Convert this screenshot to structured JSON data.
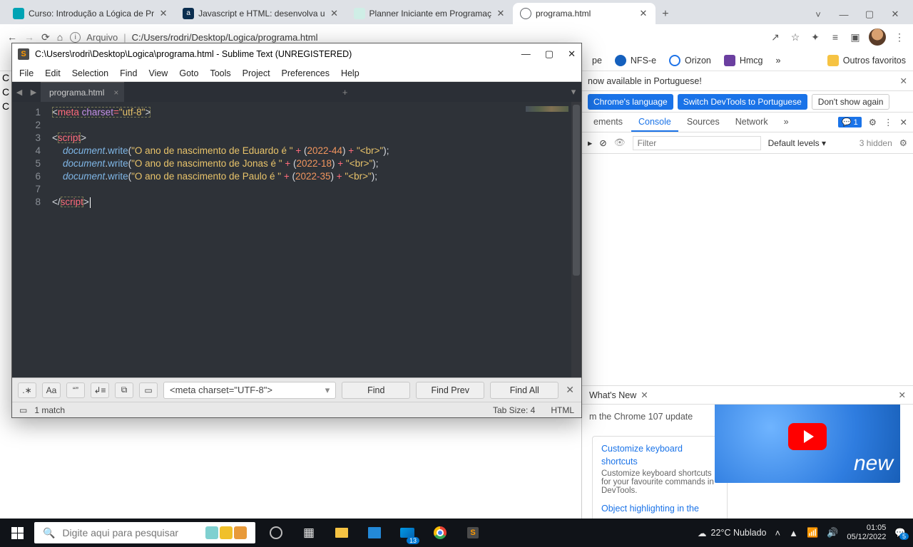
{
  "chrome": {
    "tabs": [
      {
        "title": "Curso: Introdução a Lógica de Pr",
        "favcolor": "#00a3b4"
      },
      {
        "title": "Javascript e HTML: desenvolva u",
        "favcolor": "#0b2e4f"
      },
      {
        "title": "Planner Iniciante em Programaç",
        "favcolor": "#7fc4b5"
      },
      {
        "title": "programa.html",
        "favcolor": "#5f6368",
        "active": true
      }
    ],
    "newtab_tip": "+",
    "wincontrols": {
      "chevron": "˅",
      "min": "—",
      "max": "▢",
      "close": "✕"
    },
    "toolbar": {
      "url_scheme": "Arquivo",
      "url_path": "C:/Users/rodri/Desktop/Logica/programa.html",
      "share": "↗",
      "star": "☆",
      "ext": "✦",
      "list": "≡",
      "panel": "▣",
      "menu": "⋮"
    },
    "bookmarks": {
      "left_cut": "pe",
      "items": [
        {
          "label": "NFS-e",
          "color": "#1560bd"
        },
        {
          "label": "Orizon",
          "color": "#1e73e8"
        },
        {
          "label": "Hmcg",
          "color": "#6b3fa0"
        }
      ],
      "overflow": "»",
      "other": "Outros favoritos",
      "folder": "📁"
    }
  },
  "devtools": {
    "lang_msg": "now available in Portuguese!",
    "btn_lang_chrome": "Chrome's language",
    "btn_lang_pt": "Switch DevTools to Portuguese",
    "btn_dont": "Don't show again",
    "tabs": {
      "elements": "ements",
      "console": "Console",
      "sources": "Sources",
      "network": "Network",
      "more": "»"
    },
    "issues_count": "1",
    "gear": "⚙",
    "kebab": "⋮",
    "close": "✕",
    "filter_placeholder": "Filter",
    "levels": "Default levels ▾",
    "hidden": "3 hidden",
    "hidden_gear": "⚙",
    "top": "▸",
    "eye": "👁",
    "clear": "⊘",
    "drawer": {
      "title": "What's New",
      "close": "✕",
      "subtitle": "m the Chrome 107 update",
      "card1_link1": "Customize keyboard",
      "card1_link2": "shortcuts",
      "card1_text": "Customize keyboard shortcuts for your favourite commands in DevTools.",
      "card2_link": "Object highlighting in the",
      "video_label": "new"
    }
  },
  "page_left_lines": [
    "C",
    "C",
    "C"
  ],
  "sublime": {
    "title": "C:\\Users\\rodri\\Desktop\\Logica\\programa.html - Sublime Text (UNREGISTERED)",
    "logo": "S",
    "win_min": "—",
    "win_max": "▢",
    "win_close": "✕",
    "menu": [
      "File",
      "Edit",
      "Selection",
      "Find",
      "View",
      "Goto",
      "Tools",
      "Project",
      "Preferences",
      "Help"
    ],
    "tab_name": "programa.html",
    "tab_x": "×",
    "tab_plus": "+",
    "tab_dd": "▾",
    "nav_l": "◀",
    "nav_r": "▶",
    "code": {
      "l1": {
        "open": "<",
        "tag": "meta",
        "sp": " ",
        "attr": "charset",
        "eq": "=",
        "val": "\"utf-8\"",
        "close": ">"
      },
      "l3": {
        "open": "<",
        "tag": "script",
        "close": ">"
      },
      "doc": "document",
      "dot": ".",
      "write": "write",
      "lp": "(",
      "s4a": "\"O ano de nascimento de Eduardo é \"",
      "plus": " + ",
      "n4a": "2022",
      "minus": "-",
      "n4b": "44",
      "s4b": "\"<br>\"",
      "rp": ")",
      "semi": ";",
      "s5a": "\"O ano de nascimento de Jonas é \"",
      "n5b": "18",
      "s6a": "\"O ano de nascimento de Paulo é \"",
      "n6b": "35",
      "l8": {
        "open": "</",
        "tag": "script",
        "close": ">"
      }
    },
    "find": {
      "opts": [
        ".∗",
        "Aa",
        "“”",
        "↲≡",
        "⧉",
        "▭"
      ],
      "input": "<meta charset=\"UTF-8\">",
      "dd": "▾",
      "find": "Find",
      "prev": "Find Prev",
      "all": "Find All",
      "close": "✕"
    },
    "status": {
      "sel": "▭",
      "match": "1 match",
      "tabsize": "Tab Size: 4",
      "lang": "HTML"
    }
  },
  "taskbar": {
    "search_placeholder": "Digite aqui para pesquisar",
    "search_icon": "🔍",
    "weather": "22°C  Nublado",
    "time": "01:05",
    "date": "05/12/2022",
    "tray": {
      "up": "˄",
      "drive": "▲",
      "wifi": "📶",
      "vol": "🔊"
    },
    "notif": "5"
  }
}
